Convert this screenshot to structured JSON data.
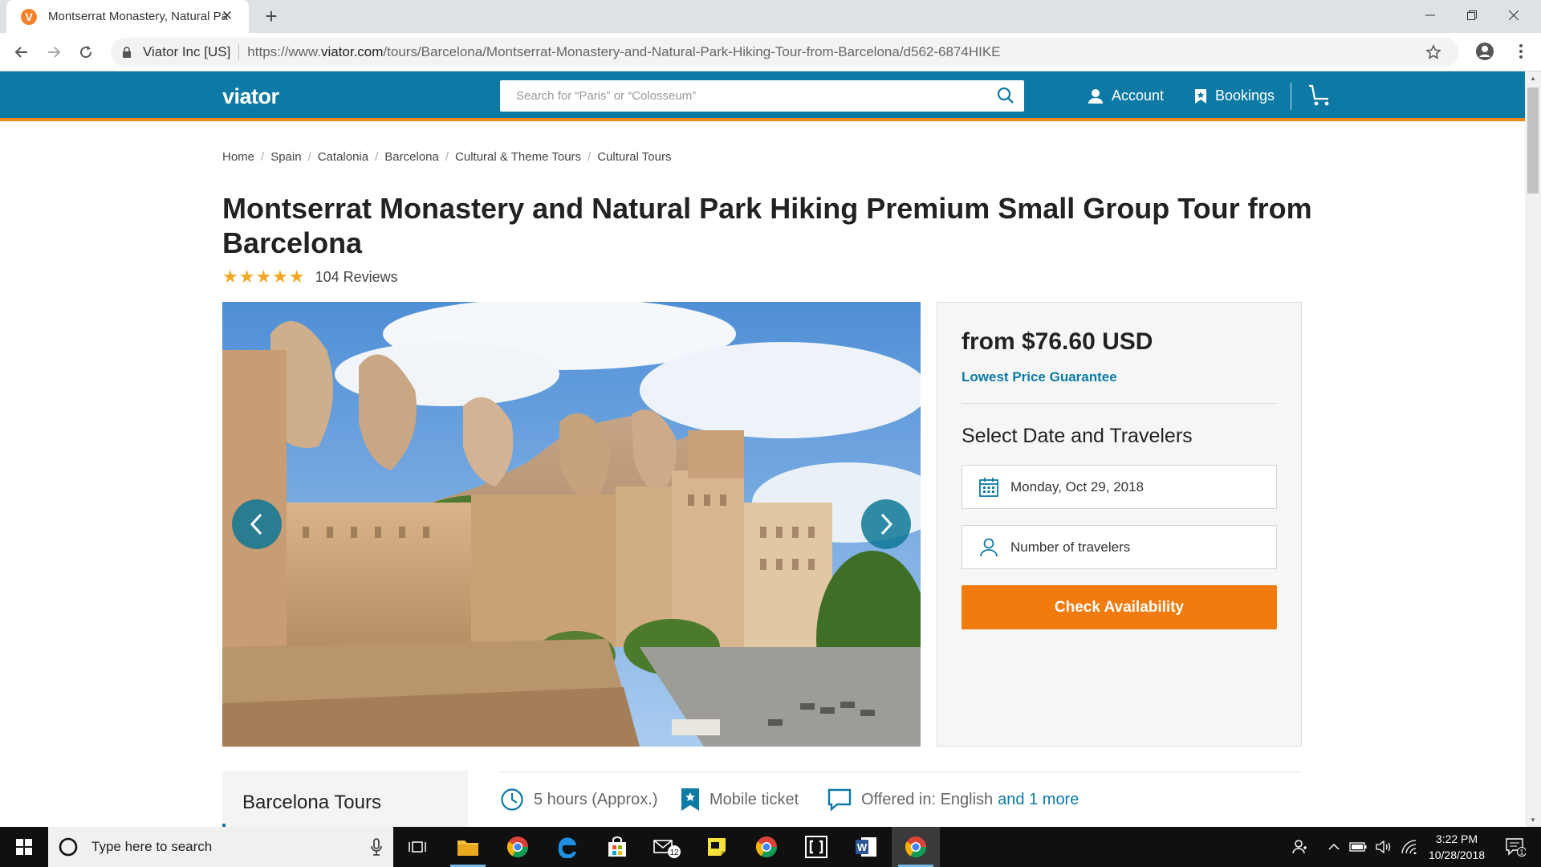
{
  "browser": {
    "tab_title": "Montserrat Monastery, Natural Park Hiking Tour",
    "new_tab_label": "+",
    "site_identity": "Viator Inc [US]",
    "url_prefix": "https://www.",
    "url_domain": "viator.com",
    "url_path": "/tours/Barcelona/Montserrat-Monastery-and-Natural-Park-Hiking-Tour-from-Barcelona/d562-6874HIKE",
    "favicon_letter": "V"
  },
  "header": {
    "logo": "viator",
    "search_placeholder": "Search for “Paris” or “Colosseum”",
    "account_label": "Account",
    "bookings_label": "Bookings",
    "brand_color": "#0d7aa6",
    "accent_color": "#f0881c"
  },
  "breadcrumb": [
    {
      "label": "Home"
    },
    {
      "label": "Spain"
    },
    {
      "label": "Catalonia"
    },
    {
      "label": "Barcelona"
    },
    {
      "label": "Cultural & Theme Tours"
    },
    {
      "label": "Cultural Tours"
    }
  ],
  "product": {
    "title": "Montserrat Monastery and Natural Park Hiking Premium Small Group Tour from Barcelona",
    "rating_stars": 5,
    "stars_text": "★★★★★",
    "reviews": "104 Reviews"
  },
  "booking": {
    "price": "from $76.60 USD",
    "guarantee": "Lowest Price Guarantee",
    "heading": "Select Date and Travelers",
    "date_value": "Monday, Oct 29, 2018",
    "travelers_placeholder": "Number of travelers",
    "cta": "Check Availability",
    "cta_color": "#f17b0d"
  },
  "sidebar": {
    "title": "Barcelona Tours"
  },
  "features": {
    "duration": "5 hours (Approx.)",
    "ticket": "Mobile ticket",
    "offered": "Offered in: English",
    "offered_more": "and 1 more"
  },
  "taskbar": {
    "search_placeholder": "Type here to search",
    "time": "3:22 PM",
    "date": "10/28/2018",
    "mail_badge": "12",
    "notification_count": "1"
  }
}
